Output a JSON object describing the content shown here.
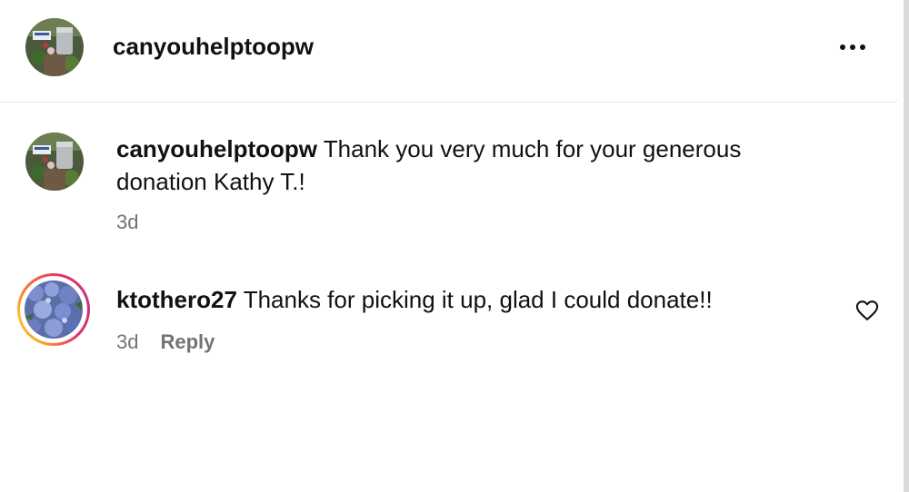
{
  "header": {
    "username": "canyouhelptoopw",
    "more_icon": "more-horizontal-icon"
  },
  "comments": [
    {
      "username": "canyouhelptoopw",
      "text": "Thank you very much for your generous donation Kathy T.!",
      "time": "3d",
      "has_story_ring": false
    },
    {
      "username": "ktothero27",
      "text": "Thanks for picking it up, glad I could donate!!",
      "time": "3d",
      "reply_label": "Reply",
      "like_icon": "heart-outline-icon",
      "has_story_ring": true
    }
  ],
  "colors": {
    "text": "#111111",
    "muted": "#737373",
    "divider": "#e6e6e6"
  }
}
